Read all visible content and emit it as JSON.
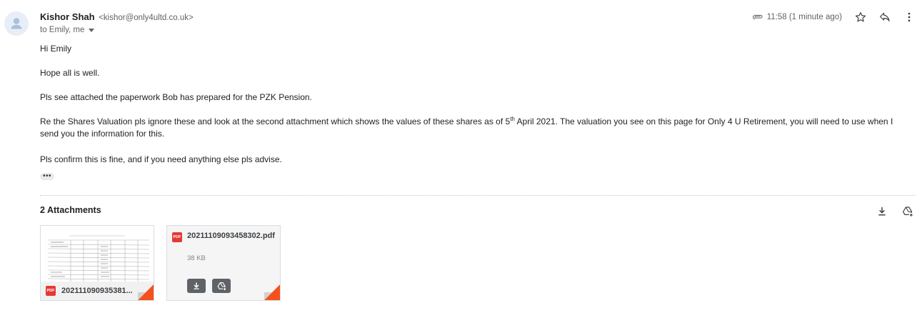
{
  "email": {
    "sender_name": "Kishor Shah",
    "sender_email": "<kishor@only4ultd.co.uk>",
    "recipients": "to Emily, me",
    "time": "11:58 (1 minute ago)"
  },
  "body": {
    "greeting": "Hi Emily",
    "line1": "Hope all is well.",
    "line2": "Pls see attached the paperwork Bob has prepared for the PZK Pension.",
    "line3_part1": "Re the Shares Valuation pls ignore these and look at the second attachment which shows the values of these shares as of 5",
    "line3_sup": "th",
    "line3_part2": " April 2021. The valuation you see on this page for Only 4 U Retirement, you will need to use when I send you the information for this.",
    "line4": "Pls confirm this is fine, and if you need anything else pls advise.",
    "trimmed_content_label": "•••"
  },
  "attachments": {
    "title": "2 Attachments",
    "items": [
      {
        "name": "202111090935381...",
        "badge": "PDF"
      },
      {
        "name": "20211109093458302.pdf",
        "badge": "PDF",
        "size": "38 KB"
      }
    ]
  },
  "icons": {
    "avatar": "person-avatar-icon",
    "attachment": "paperclip-icon",
    "star": "star-icon",
    "reply": "reply-icon",
    "more": "more-vert-icon",
    "download_all": "download-icon",
    "add_to_drive": "add-to-drive-icon",
    "expand": "chevron-down-icon"
  },
  "colors": {
    "pdf_red": "#e53935",
    "corner_orange": "#f4511e",
    "secondary_text": "#5f6368"
  }
}
